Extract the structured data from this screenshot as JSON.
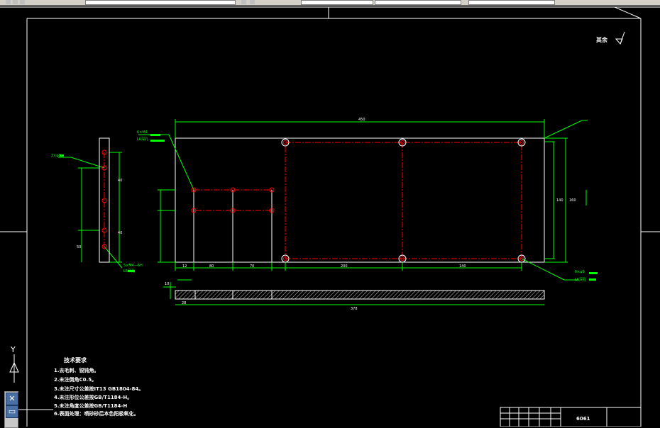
{
  "app": {
    "toolbar_colors": {
      "bg": "#d4d0c8",
      "field": "#ffffff"
    }
  },
  "colors": {
    "canvas": "#000000",
    "outline": "#ffffff",
    "dimension": "#00ff00",
    "centerline": "#ff0000",
    "hatch": "#ffffff"
  },
  "drawing": {
    "overall_length": "450",
    "height_right": "140",
    "height_right_outer": "160",
    "small_hole_callout": "6×M4",
    "small_hole_depth": "L6深孔",
    "big_hole_callout": "6×φ9",
    "big_hole_depth": "L6深孔",
    "side_hole_callout": "2×φ9",
    "side_hole_callout2": "5×M4—6H",
    "side_hole_depth": "L6深孔",
    "dims_bottom": [
      "12",
      "80",
      "70",
      "200",
      "140"
    ],
    "side_dims": [
      "40",
      "40",
      "50"
    ],
    "section_length": "378",
    "section_thk": "10",
    "section_w": "28",
    "roughness_label": "其余",
    "roughness_symbol": "▽",
    "ucs_label": "Y"
  },
  "requirements": {
    "title": "技术要求",
    "items": [
      "1.去毛刺、锐钝角。",
      "2.未注倒角C0.5。",
      "3.未注尺寸公差按IT13 GB1804-84。",
      "4.未注形位公差按GB/T1184-H。",
      "5.未注角度公差按GB/T1184-H",
      "6.表面处理：喷砂砂后本色阳极氧化。"
    ]
  },
  "titleblock": {
    "part_number": "6061"
  },
  "icons": {
    "ucs_top": "ucs-icon",
    "ucs_bottom": "layout-icon"
  }
}
